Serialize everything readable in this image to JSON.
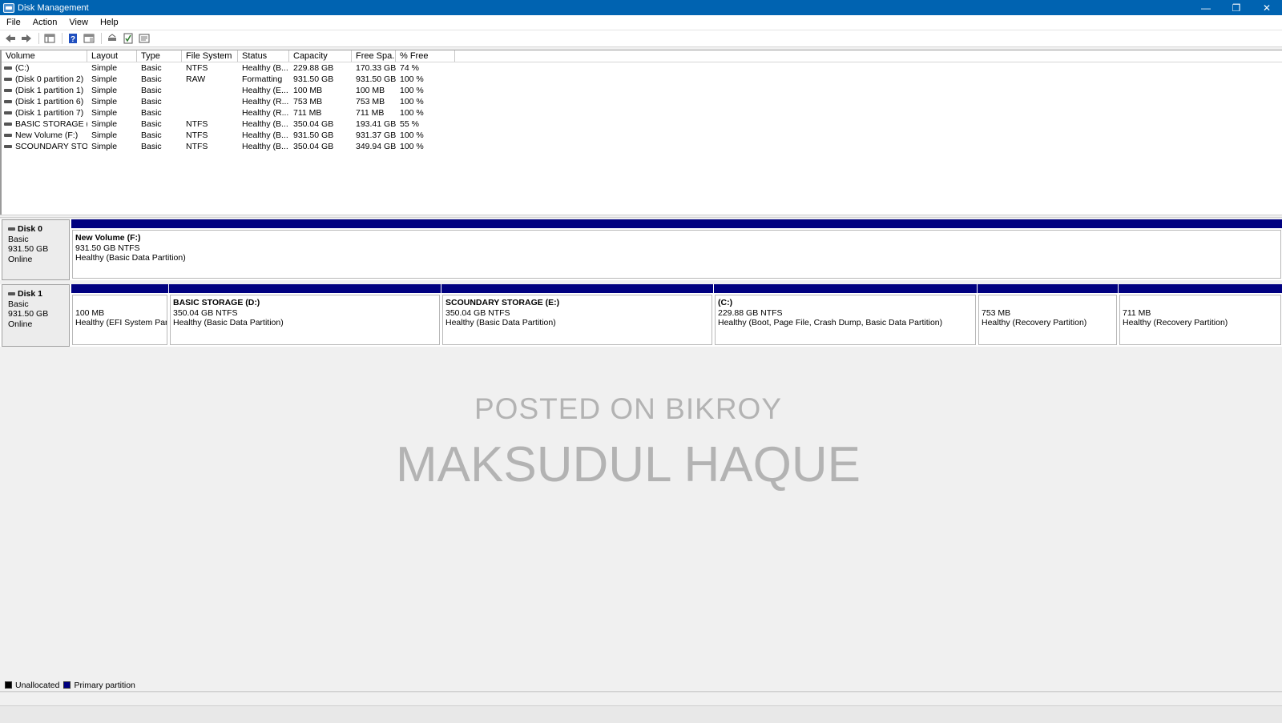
{
  "window": {
    "title": "Disk Management",
    "minimize": "—",
    "restore": "❐",
    "close": "✕"
  },
  "menu": [
    "File",
    "Action",
    "View",
    "Help"
  ],
  "toolbar": [
    "back-icon",
    "forward-icon",
    "console-icon",
    "help-icon",
    "properties-icon",
    "rescan-icon",
    "check-icon",
    "settings-icon"
  ],
  "columns": [
    "Volume",
    "Layout",
    "Type",
    "File System",
    "Status",
    "Capacity",
    "Free Spa...",
    "% Free"
  ],
  "volumes": [
    {
      "volume": " (C:)",
      "layout": "Simple",
      "type": "Basic",
      "fs": "NTFS",
      "status": "Healthy (B...",
      "capacity": "229.88 GB",
      "free": "170.33 GB",
      "pct": "74 %"
    },
    {
      "volume": "(Disk 0 partition 2)",
      "layout": "Simple",
      "type": "Basic",
      "fs": "RAW",
      "status": "Formatting",
      "capacity": "931.50 GB",
      "free": "931.50 GB",
      "pct": "100 %"
    },
    {
      "volume": "(Disk 1 partition 1)",
      "layout": "Simple",
      "type": "Basic",
      "fs": "",
      "status": "Healthy (E...",
      "capacity": "100 MB",
      "free": "100 MB",
      "pct": "100 %"
    },
    {
      "volume": "(Disk 1 partition 6)",
      "layout": "Simple",
      "type": "Basic",
      "fs": "",
      "status": "Healthy (R...",
      "capacity": "753 MB",
      "free": "753 MB",
      "pct": "100 %"
    },
    {
      "volume": "(Disk 1 partition 7)",
      "layout": "Simple",
      "type": "Basic",
      "fs": "",
      "status": "Healthy (R...",
      "capacity": "711 MB",
      "free": "711 MB",
      "pct": "100 %"
    },
    {
      "volume": "BASIC STORAGE (D:)",
      "layout": "Simple",
      "type": "Basic",
      "fs": "NTFS",
      "status": "Healthy (B...",
      "capacity": "350.04 GB",
      "free": "193.41 GB",
      "pct": "55 %"
    },
    {
      "volume": "New Volume (F:)",
      "layout": "Simple",
      "type": "Basic",
      "fs": "NTFS",
      "status": "Healthy (B...",
      "capacity": "931.50 GB",
      "free": "931.37 GB",
      "pct": "100 %"
    },
    {
      "volume": "SCOUNDARY STO...",
      "layout": "Simple",
      "type": "Basic",
      "fs": "NTFS",
      "status": "Healthy (B...",
      "capacity": "350.04 GB",
      "free": "349.94 GB",
      "pct": "100 %"
    }
  ],
  "disks": [
    {
      "name": "Disk 0",
      "type": "Basic",
      "size": "931.50 GB",
      "state": "Online",
      "partitions": [
        {
          "name": "New Volume  (F:)",
          "size": "931.50 GB NTFS",
          "status": "Healthy (Basic Data Partition)"
        }
      ]
    },
    {
      "name": "Disk 1",
      "type": "Basic",
      "size": "931.50 GB",
      "state": "Online",
      "partitions": [
        {
          "name": "",
          "size": "100 MB",
          "status": "Healthy (EFI System Partit"
        },
        {
          "name": "BASIC STORAGE  (D:)",
          "size": "350.04 GB NTFS",
          "status": "Healthy (Basic Data Partition)"
        },
        {
          "name": "SCOUNDARY STORAGE  (E:)",
          "size": "350.04 GB NTFS",
          "status": "Healthy (Basic Data Partition)"
        },
        {
          "name": " (C:)",
          "size": "229.88 GB NTFS",
          "status": "Healthy (Boot, Page File, Crash Dump, Basic Data Partition)"
        },
        {
          "name": "",
          "size": "753 MB",
          "status": "Healthy (Recovery Partition)"
        },
        {
          "name": "",
          "size": "711 MB",
          "status": "Healthy (Recovery Partition)"
        }
      ]
    }
  ],
  "watermark": {
    "line1": "POSTED ON BIKROY",
    "line2": "MAKSUDUL HAQUE"
  },
  "legend": [
    {
      "label": "Unallocated",
      "color": "#000000"
    },
    {
      "label": "Primary partition",
      "color": "#000080"
    }
  ],
  "colors": {
    "titlebar": "#0063b1",
    "primary_partition": "#000080"
  }
}
